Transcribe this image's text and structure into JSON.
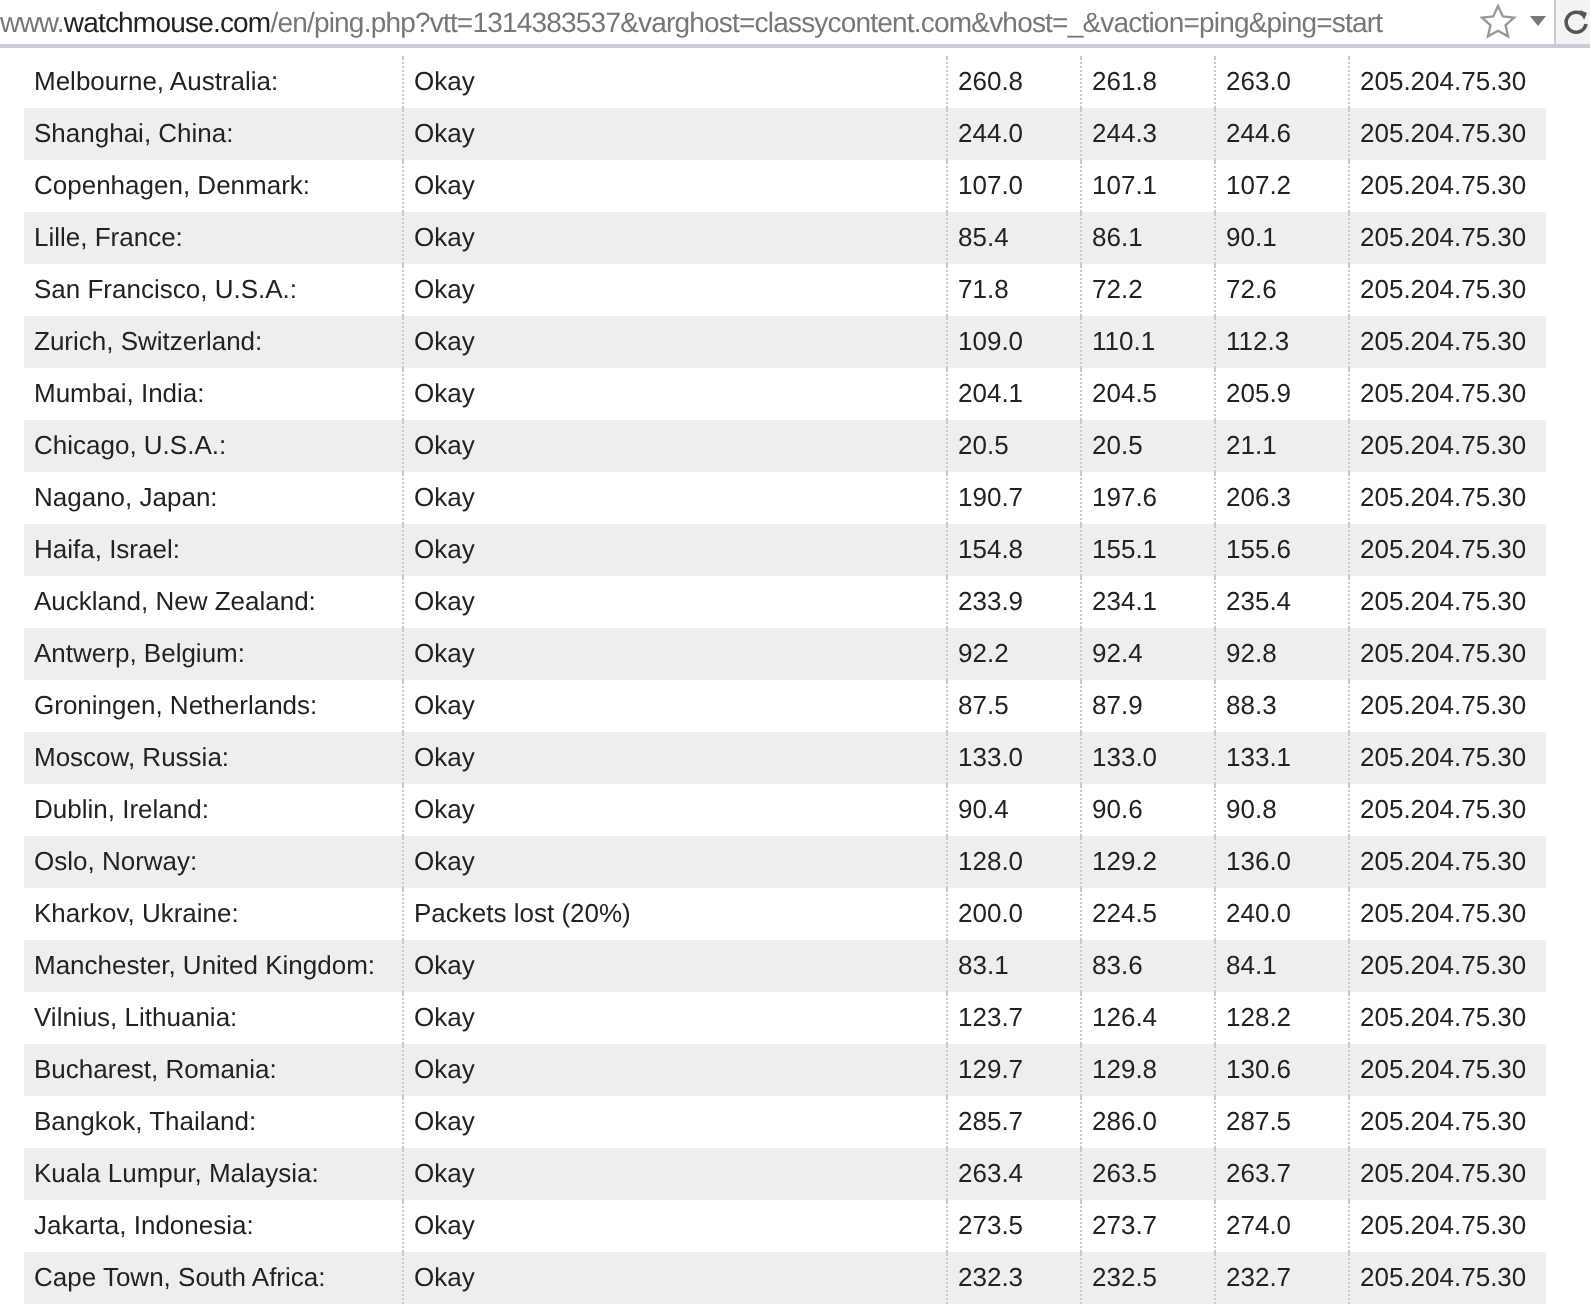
{
  "address_bar": {
    "prefix": "www.",
    "domain": "watchmouse.com",
    "path": "/en/ping.php?vtt=1314383537&varghost=classycontent.com&vhost=_&vaction=ping&ping=start"
  },
  "table": {
    "rows": [
      [
        "Melbourne, Australia:",
        "Okay",
        "260.8",
        "261.8",
        "263.0",
        "205.204.75.30"
      ],
      [
        "Shanghai, China:",
        "Okay",
        "244.0",
        "244.3",
        "244.6",
        "205.204.75.30"
      ],
      [
        "Copenhagen, Denmark:",
        "Okay",
        "107.0",
        "107.1",
        "107.2",
        "205.204.75.30"
      ],
      [
        "Lille, France:",
        "Okay",
        "85.4",
        "86.1",
        "90.1",
        "205.204.75.30"
      ],
      [
        "San Francisco, U.S.A.:",
        "Okay",
        "71.8",
        "72.2",
        "72.6",
        "205.204.75.30"
      ],
      [
        "Zurich, Switzerland:",
        "Okay",
        "109.0",
        "110.1",
        "112.3",
        "205.204.75.30"
      ],
      [
        "Mumbai, India:",
        "Okay",
        "204.1",
        "204.5",
        "205.9",
        "205.204.75.30"
      ],
      [
        "Chicago, U.S.A.:",
        "Okay",
        "20.5",
        "20.5",
        "21.1",
        "205.204.75.30"
      ],
      [
        "Nagano, Japan:",
        "Okay",
        "190.7",
        "197.6",
        "206.3",
        "205.204.75.30"
      ],
      [
        "Haifa, Israel:",
        "Okay",
        "154.8",
        "155.1",
        "155.6",
        "205.204.75.30"
      ],
      [
        "Auckland, New Zealand:",
        "Okay",
        "233.9",
        "234.1",
        "235.4",
        "205.204.75.30"
      ],
      [
        "Antwerp, Belgium:",
        "Okay",
        "92.2",
        "92.4",
        "92.8",
        "205.204.75.30"
      ],
      [
        "Groningen, Netherlands:",
        "Okay",
        "87.5",
        "87.9",
        "88.3",
        "205.204.75.30"
      ],
      [
        "Moscow, Russia:",
        "Okay",
        "133.0",
        "133.0",
        "133.1",
        "205.204.75.30"
      ],
      [
        "Dublin, Ireland:",
        "Okay",
        "90.4",
        "90.6",
        "90.8",
        "205.204.75.30"
      ],
      [
        "Oslo, Norway:",
        "Okay",
        "128.0",
        "129.2",
        "136.0",
        "205.204.75.30"
      ],
      [
        "Kharkov, Ukraine:",
        "Packets lost (20%)",
        "200.0",
        "224.5",
        "240.0",
        "205.204.75.30"
      ],
      [
        "Manchester, United Kingdom:",
        "Okay",
        "83.1",
        "83.6",
        "84.1",
        "205.204.75.30"
      ],
      [
        "Vilnius, Lithuania:",
        "Okay",
        "123.7",
        "126.4",
        "128.2",
        "205.204.75.30"
      ],
      [
        "Bucharest, Romania:",
        "Okay",
        "129.7",
        "129.8",
        "130.6",
        "205.204.75.30"
      ],
      [
        "Bangkok, Thailand:",
        "Okay",
        "285.7",
        "286.0",
        "287.5",
        "205.204.75.30"
      ],
      [
        "Kuala Lumpur, Malaysia:",
        "Okay",
        "263.4",
        "263.5",
        "263.7",
        "205.204.75.30"
      ],
      [
        "Jakarta, Indonesia:",
        "Okay",
        "273.5",
        "273.7",
        "274.0",
        "205.204.75.30"
      ],
      [
        "Cape Town, South Africa:",
        "Okay",
        "232.3",
        "232.5",
        "232.7",
        "205.204.75.30"
      ]
    ]
  }
}
